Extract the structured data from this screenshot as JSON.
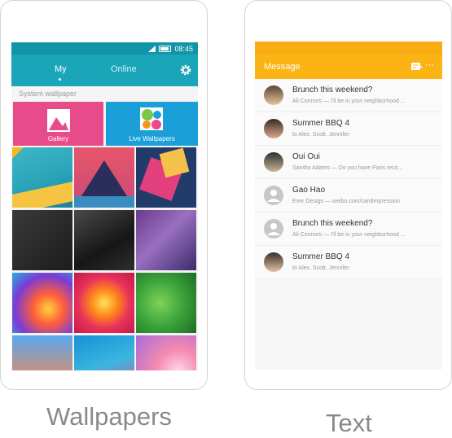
{
  "wallpapers_app": {
    "status_time": "08:45",
    "tabs": [
      {
        "label": "My",
        "active": true
      },
      {
        "label": "Online",
        "active": false
      }
    ],
    "section_label": "System wallpaper",
    "gallery_label": "Gallery",
    "live_label": "Live Wallpapers"
  },
  "message_app": {
    "title": "Message",
    "threads": [
      {
        "name": "Brunch this weekend?",
        "preview": "Ali Connors — I'll be in your neighborhood ...",
        "avatar": "photo"
      },
      {
        "name": "Summer BBQ  4",
        "preview": "to Alex, Scott, Jennifer",
        "avatar": "photo"
      },
      {
        "name": "Oui Oui",
        "preview": "Sandra Adams — Do you have Paris reco...",
        "avatar": "photo"
      },
      {
        "name": "Gao Hao",
        "preview": "Ever Design — weibo.com/cardimpression",
        "avatar": "placeholder"
      },
      {
        "name": "Brunch this weekend?",
        "preview": "Ali Connors — I'll be in your neighborhood ...",
        "avatar": "placeholder"
      },
      {
        "name": "Summer BBQ  4",
        "preview": "to Alex, Scott, Jennifer",
        "avatar": "photo"
      }
    ]
  },
  "captions": {
    "left": "Wallpapers",
    "right": "Text"
  },
  "colors": {
    "teal": "#1aa5b8",
    "orange": "#fbb414",
    "gallery": "#e84b8a",
    "live": "#1a9fd9"
  }
}
